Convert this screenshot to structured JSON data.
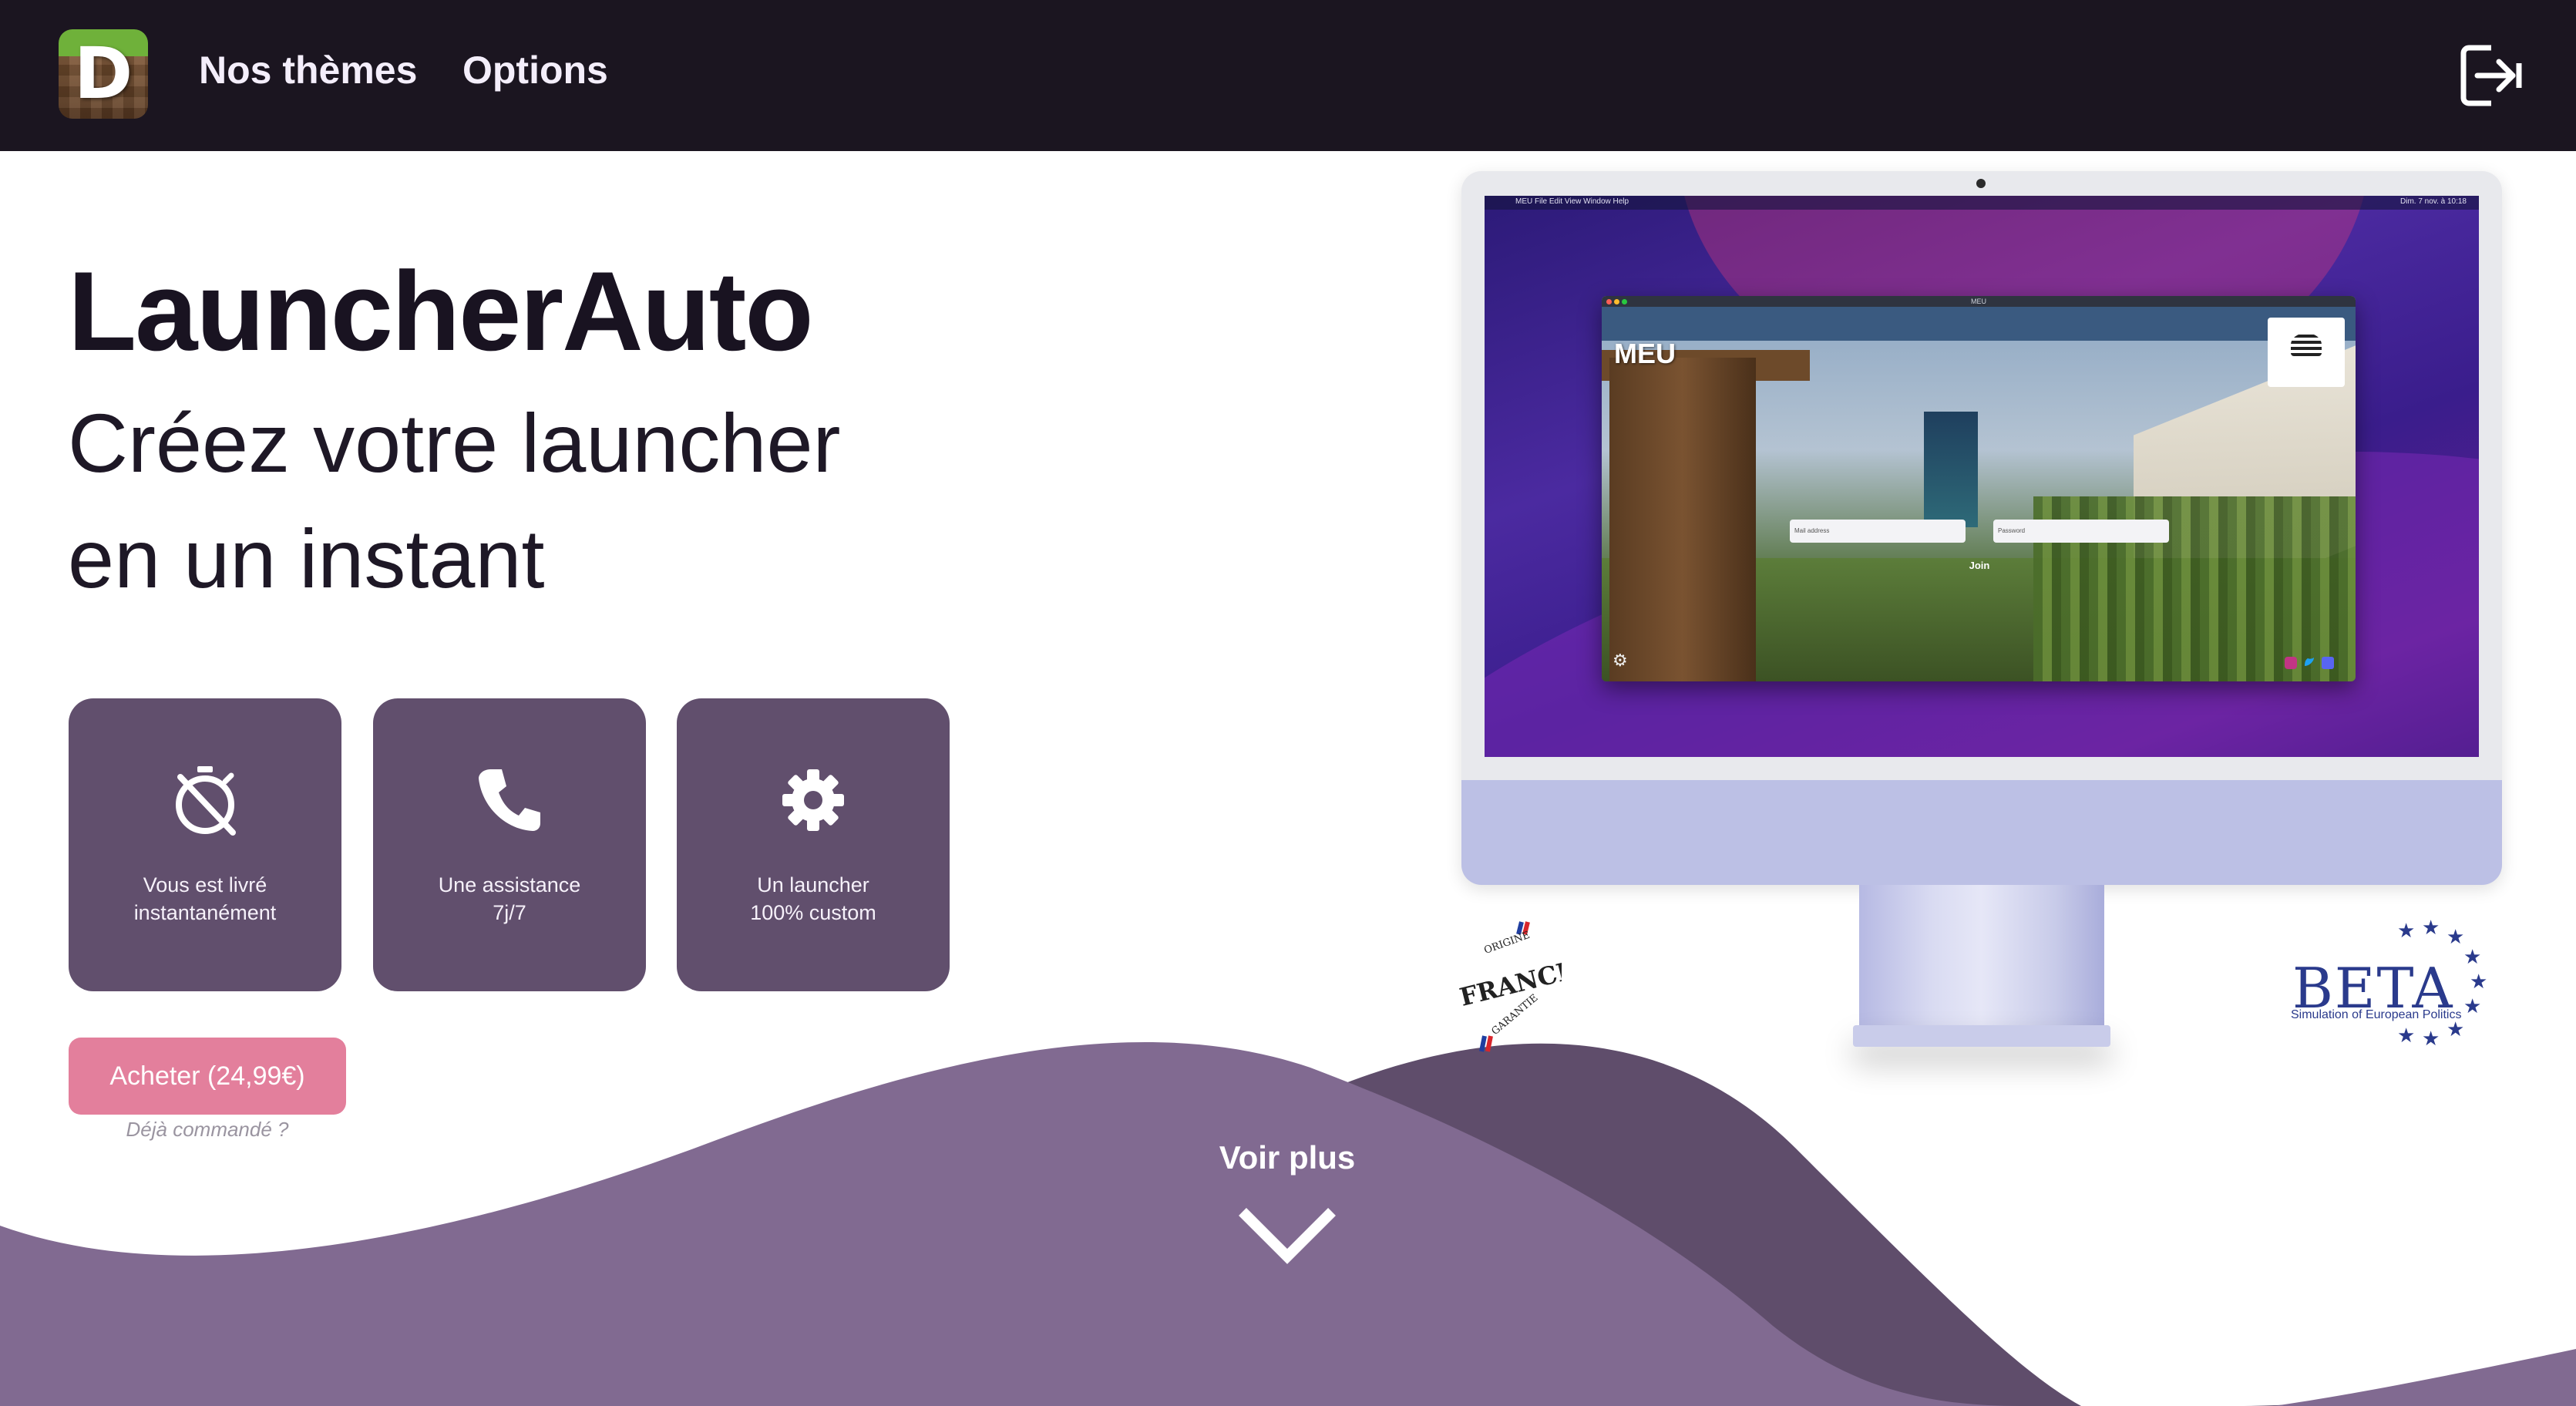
{
  "header": {
    "logo_letter": "D",
    "nav": {
      "themes": "Nos thèmes",
      "options": "Options"
    },
    "logout_icon": "logout-icon"
  },
  "hero": {
    "title": "LauncherAuto",
    "subtitle_line1": "Créez votre launcher",
    "subtitle_line2": "en un instant"
  },
  "features": [
    {
      "icon": "timer-off-icon",
      "line1": "Vous est livré",
      "line2": "instantanément"
    },
    {
      "icon": "phone-icon",
      "line1": "Une assistance",
      "line2": "7j/7"
    },
    {
      "icon": "gear-icon",
      "line1": "Un launcher",
      "line2": "100% custom"
    }
  ],
  "cta": {
    "buy_label": "Acheter (24,99€)",
    "already_ordered": "Déjà commandé ?"
  },
  "preview": {
    "menubar_left": "MEU   File   Edit   View   Window   Help",
    "menubar_right": "Dim. 7 nov. à 10:18",
    "window_title": "MEU",
    "app_name": "MEU",
    "username_placeholder": "Mail address",
    "password_placeholder": "Password",
    "join_label": "Join"
  },
  "badges": {
    "france_text": "FRANCE",
    "france_ring_top": "ORIGINE",
    "france_ring_bottom": "GARANTIE",
    "beta_title": "BETA",
    "beta_subtitle": "Simulation of European Politics"
  },
  "footer": {
    "see_more": "Voir plus",
    "chevron_icon": "chevron-down-icon"
  },
  "colors": {
    "topbar": "#1b1520",
    "card": "#614f6d",
    "buy": "#e37f9c",
    "wave_light": "#816a91",
    "wave_dark": "#5f4d6b"
  }
}
